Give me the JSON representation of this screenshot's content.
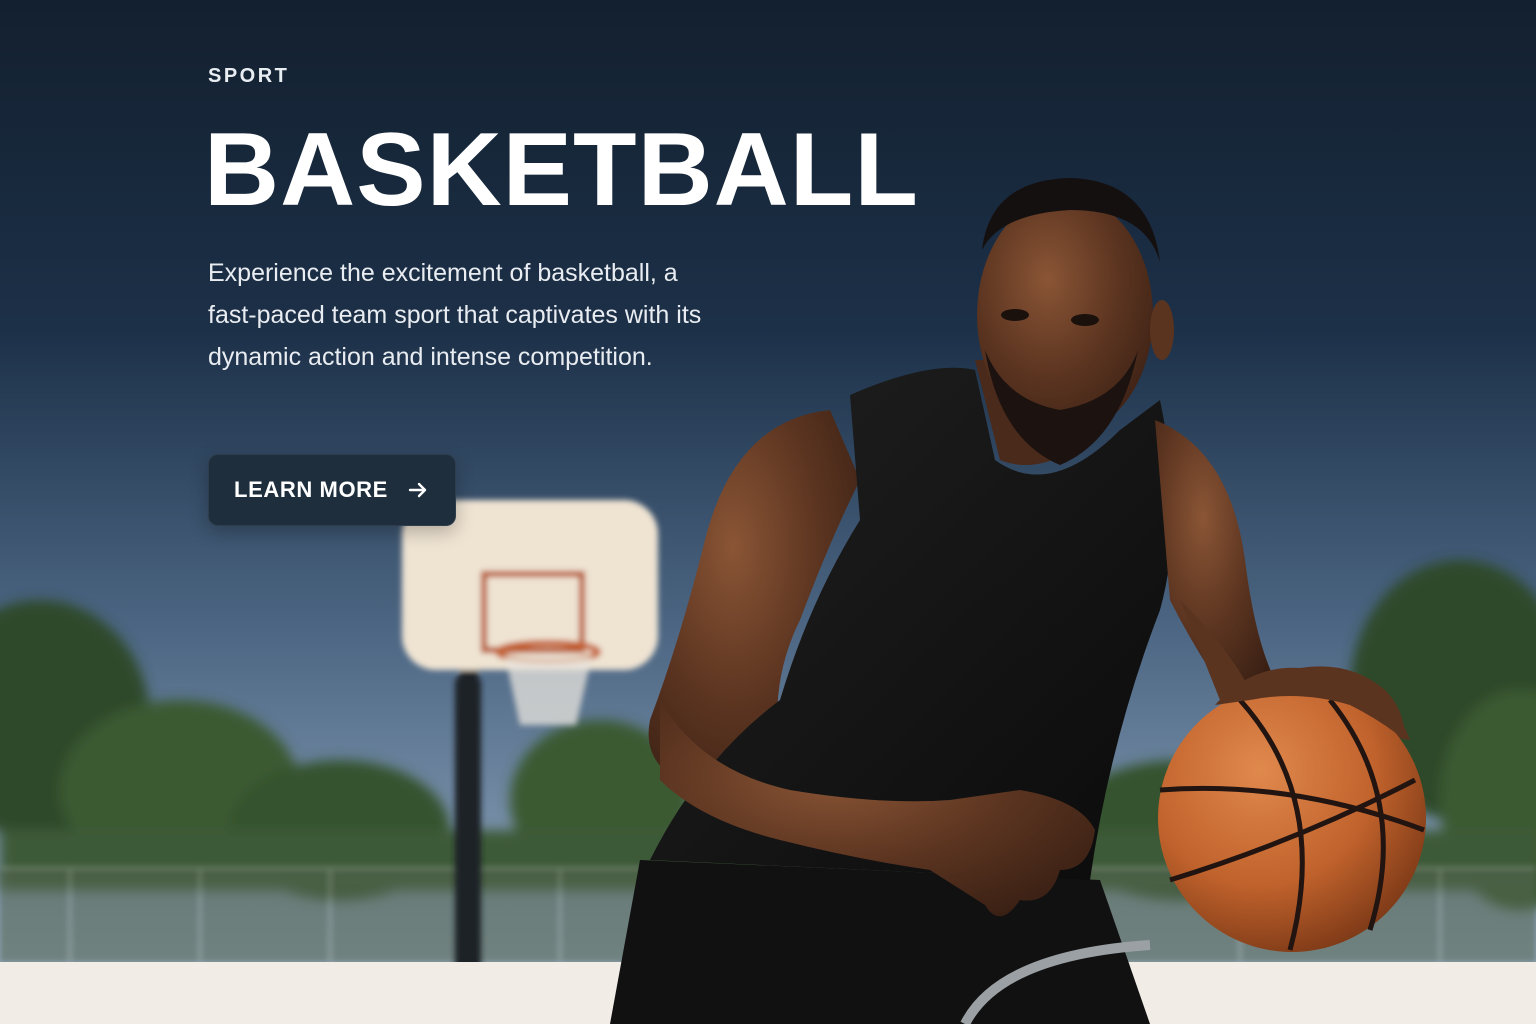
{
  "hero": {
    "eyebrow": "SPORT",
    "title": "BASKETBALL",
    "description": "Experience the excitement of basketball, a fast-paced team sport that captivates with its dynamic action and intense competition.",
    "cta": {
      "label": "LEARN MORE",
      "icon": "arrow-right-icon"
    },
    "image": {
      "subject": "basketball-player-photo"
    }
  },
  "colors": {
    "sky_top": "#13202f",
    "sky_bottom": "#7d94ad",
    "button_bg": "#1e2e3d",
    "text": "#ffffff",
    "ball": "#c96a32"
  }
}
